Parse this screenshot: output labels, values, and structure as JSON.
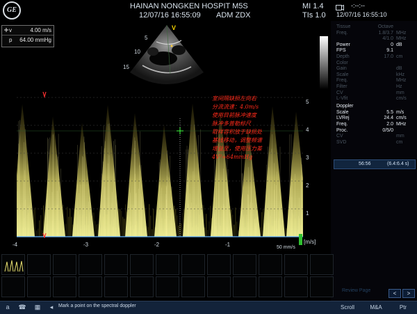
{
  "header": {
    "hospital": "HAINAN NONGKEN HOSPIT M5S",
    "datetime": "12/07/16 16:55:09",
    "operator": "ADM ZDX",
    "mi": "MI 1.4",
    "tis": "TIs 1.0",
    "dashes": "-:--:--",
    "datetime_right": "12/07/16 16:55:10",
    "logo_text": "GE"
  },
  "measure": {
    "v_label": "v",
    "v_value": "4.00 m/s",
    "p_label": "p",
    "p_value": "64.00 mmHg"
  },
  "image_params": [
    {
      "label": "Tissue",
      "value": "Octave",
      "unit": "",
      "style": "dim"
    },
    {
      "label": "Freq.",
      "value": "1.8/3.7",
      "unit": "MHz",
      "style": "dim"
    },
    {
      "label": "",
      "value": "4/1.0",
      "unit": "MHz",
      "style": "dim"
    },
    {
      "label": "Power",
      "value": "0",
      "unit": "dB",
      "style": "bright"
    },
    {
      "label": "FPS",
      "value": "9.1",
      "unit": "",
      "style": "bright"
    },
    {
      "label": "Depth",
      "value": "17.0",
      "unit": "cm",
      "style": "dim"
    },
    {
      "label": "Color",
      "value": "",
      "unit": "",
      "style": "dim"
    },
    {
      "label": "Gain",
      "value": "",
      "unit": "dB",
      "style": "dim"
    },
    {
      "label": "Scale",
      "value": "",
      "unit": "kHz",
      "style": "dim"
    },
    {
      "label": "Freq.",
      "value": "",
      "unit": "MHz",
      "style": "dim"
    },
    {
      "label": "Filter",
      "value": "",
      "unit": "Hz",
      "style": "dim"
    },
    {
      "label": "CV",
      "value": "",
      "unit": "mm",
      "style": "dim"
    },
    {
      "label": "L-Vfit",
      "value": "",
      "unit": "cm/s",
      "style": "dim"
    }
  ],
  "doppler_title": "Doppler",
  "doppler_params": [
    {
      "label": "Scale",
      "value": "5.5",
      "unit": "m/s",
      "style": "bright"
    },
    {
      "label": "LVRej",
      "value": "24.4",
      "unit": "cm/s",
      "style": "bright"
    },
    {
      "label": "Freq.",
      "value": "2.0",
      "unit": "MHz",
      "style": "bright"
    },
    {
      "label": "Proc.",
      "value": "0/5/0",
      "unit": "",
      "style": "bright"
    },
    {
      "label": "CV",
      "value": "",
      "unit": "mm",
      "style": "dim"
    },
    {
      "label": "SVD",
      "value": "",
      "unit": "cm",
      "style": "dim"
    }
  ],
  "timer": {
    "elapsed": "56:56",
    "range": "(6.4:6.4 s)"
  },
  "sector_depths": [
    "5",
    "10",
    "15"
  ],
  "sector_marker": "V",
  "spectral": {
    "y_ticks": [
      "5",
      "4",
      "3",
      "2",
      "1"
    ],
    "x_ticks": [
      "-4",
      "-3",
      "-2",
      "-1"
    ],
    "unit": "[m/s]",
    "sweep": "50 mm/s"
  },
  "annotation": "室间隔缺损左向右\n分流流速：4.0m/s\n使用目前脉冲速度\n脉冲多普勒标尺\n取样容积放于缺损处\n基线移动，调整频谱\n增益至，使用压力差\n4V²=64mmHg\n",
  "status": {
    "hint": "Mark a point on the spectral doppler",
    "scroll": "Scroll",
    "ma": "M&A",
    "ptr": "Ptr",
    "review_page": "Review Page"
  },
  "colors": {
    "spectrum": "#e8e070",
    "annotation": "#ff2a1a",
    "statusbar": "#13233a"
  }
}
